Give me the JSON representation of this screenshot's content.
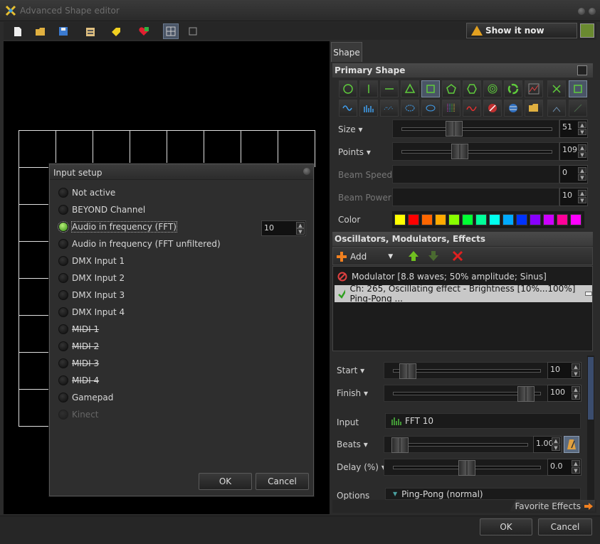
{
  "window": {
    "title": "Advanced Shape editor"
  },
  "toolbar": {
    "icons": [
      "new-file-icon",
      "open-folder-icon",
      "save-icon",
      "clipboard-icon",
      "tag-icon",
      "heart-icon",
      "grid-view-icon",
      "single-view-icon"
    ],
    "show_now": "Show it now"
  },
  "dialog": {
    "title": "Input setup",
    "options": [
      {
        "label": "Not active",
        "state": "normal"
      },
      {
        "label": "BEYOND Channel",
        "state": "normal"
      },
      {
        "label": "Audio in frequency (FFT)",
        "state": "selected"
      },
      {
        "label": "Audio in frequency (FFT unfiltered)",
        "state": "normal"
      },
      {
        "label": "DMX Input 1",
        "state": "normal"
      },
      {
        "label": "DMX Input 2",
        "state": "normal"
      },
      {
        "label": "DMX Input 3",
        "state": "normal"
      },
      {
        "label": "DMX Input 4",
        "state": "normal"
      },
      {
        "label": "MIDI 1",
        "state": "strike"
      },
      {
        "label": "MIDI 2",
        "state": "strike"
      },
      {
        "label": "MIDI 3",
        "state": "strike"
      },
      {
        "label": "MIDI 4",
        "state": "strike"
      },
      {
        "label": "Gamepad",
        "state": "normal"
      },
      {
        "label": "Kinect",
        "state": "disabled"
      }
    ],
    "fft_value": "10",
    "ok": "OK",
    "cancel": "Cancel"
  },
  "panel": {
    "tab": "Shape",
    "primary_shape": "Primary Shape",
    "size_label": "Size",
    "size_value": "51",
    "size_level": 0.33,
    "points_label": "Points",
    "points_value": "109",
    "points_level": 0.37,
    "beam_speed_label": "Beam Speed",
    "beam_speed_value": "0",
    "beam_power_label": "Beam Power",
    "beam_power_value": "10",
    "color_label": "Color",
    "colors": [
      "#ffff00",
      "#ff0000",
      "#ff6600",
      "#ffaa00",
      "#88ff00",
      "#00ff33",
      "#00ff99",
      "#00ffee",
      "#00aaff",
      "#0033ff",
      "#8800ff",
      "#cc00ff",
      "#ff0099",
      "#ff00ff"
    ],
    "fx_header": "Oscillators, Modulators, Effects",
    "add_label": "Add",
    "fx_items": [
      "Modulator [8.8 waves; 50% amplitude; Sinus]",
      "Ch: 265, Oscillating effect - Brightness [10%...100%] Ping-Pong ..."
    ],
    "start_label": "Start",
    "start_value": "10",
    "start_level": 0.05,
    "finish_label": "Finish",
    "finish_value": "100",
    "finish_level": 0.95,
    "input_label": "Input",
    "input_value": "FFT 10",
    "beats_label": "Beats",
    "beats_value": "1.00",
    "delay_label": "Delay (%)",
    "delay_value": "0.0",
    "delay_level": 0.5,
    "options_label": "Options",
    "options_value": "Ping-Pong (normal)",
    "favorite_effects": "Favorite Effects"
  },
  "footer": {
    "ok": "OK",
    "cancel": "Cancel"
  }
}
